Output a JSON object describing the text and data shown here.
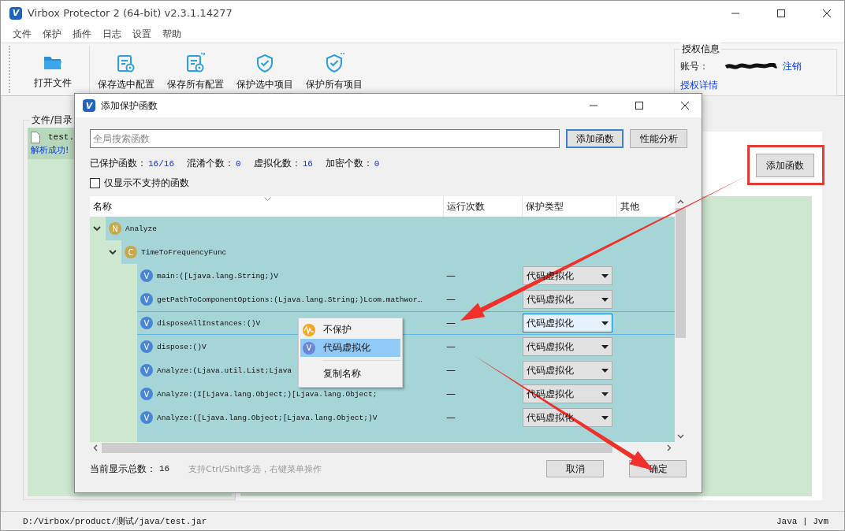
{
  "window": {
    "logo": "V",
    "title": "Virbox Protector 2 (64-bit) v2.3.1.14277"
  },
  "menu": [
    "文件",
    "保护",
    "插件",
    "日志",
    "设置",
    "帮助"
  ],
  "toolbar": [
    {
      "label": "打开文件"
    },
    {
      "label": "保存选中配置"
    },
    {
      "label": "保存所有配置"
    },
    {
      "label": "保护选中项目"
    },
    {
      "label": "保护所有项目"
    }
  ],
  "license": {
    "title": "授权信息",
    "account_label": "账号：",
    "logout": "注销",
    "details": "授权详情"
  },
  "files": {
    "title": "文件/目录",
    "items": [
      {
        "name": "test.",
        "status": "解析成功!"
      }
    ]
  },
  "right_panel": {
    "button": "添加函数"
  },
  "dialog": {
    "logo": "V",
    "title": "添加保护函数",
    "search_placeholder": "全局搜索函数",
    "buttons": [
      {
        "label": "添加函数",
        "focused": true
      },
      {
        "label": "性能分析",
        "focused": false
      }
    ],
    "stats": [
      {
        "label": "已保护函数：",
        "value": "16/16"
      },
      {
        "label": "混淆个数：",
        "value": "0"
      },
      {
        "label": "虚拟化数：",
        "value": "16"
      },
      {
        "label": "加密个数：",
        "value": "0"
      }
    ],
    "filter": {
      "label": "仅显示不支持的函数",
      "checked": false
    },
    "columns": [
      "名称",
      "运行次数",
      "保护类型",
      "其他"
    ],
    "tree": [
      {
        "kind": "namespace",
        "badge": "N",
        "name": "Analyze",
        "expanded": true,
        "selected": false,
        "children": [
          {
            "kind": "class",
            "badge": "C",
            "name": "TimeToFrequencyFunc",
            "expanded": true,
            "selected": false,
            "children": [
              {
                "kind": "method",
                "badge": "V",
                "name": "main:([Ljava.lang.String;)V",
                "runs": "—",
                "protection": "代码虚拟化",
                "selected": false
              },
              {
                "kind": "method",
                "badge": "V",
                "name": "getPathToComponentOptions:(Ljava.lang.String;)Lcom.mathwor…",
                "runs": "—",
                "protection": "代码虚拟化",
                "selected": false
              },
              {
                "kind": "method",
                "badge": "V",
                "name": "disposeAllInstances:()V",
                "runs": "—",
                "protection": "代码虚拟化",
                "selected": true
              },
              {
                "kind": "method",
                "badge": "V",
                "name": "dispose:()V",
                "runs": "—",
                "protection": "代码虚拟化",
                "selected": false
              },
              {
                "kind": "method",
                "badge": "V",
                "name": "Analyze:(Ljava.util.List;Ljava",
                "runs": "—",
                "protection": "代码虚拟化",
                "selected": false
              },
              {
                "kind": "method",
                "badge": "V",
                "name": "Analyze:(I[Ljava.lang.Object;)[Ljava.lang.Object;",
                "runs": "—",
                "protection": "代码虚拟化",
                "selected": false
              },
              {
                "kind": "method",
                "badge": "V",
                "name": "Analyze:([Ljava.lang.Object;[Ljava.lang.Object;)V",
                "runs": "—",
                "protection": "代码虚拟化",
                "selected": false
              }
            ]
          }
        ]
      }
    ],
    "context_menu": [
      {
        "label": "不保护",
        "selected": false,
        "separator_before": false
      },
      {
        "label": "代码虚拟化",
        "badge": "V",
        "selected": true,
        "separator_before": false
      },
      {
        "label": "复制名称",
        "selected": false,
        "separator_before": true
      }
    ],
    "footer": {
      "count_label": "当前显示总数：",
      "count": "16",
      "hint": "支持Ctrl/Shift多选，右键菜单操作"
    },
    "actions": [
      "取消",
      "确定"
    ]
  },
  "status_bar": {
    "path": "D:/Virbox/product/测试/java/test.jar",
    "mode": "Java | Jvm"
  }
}
